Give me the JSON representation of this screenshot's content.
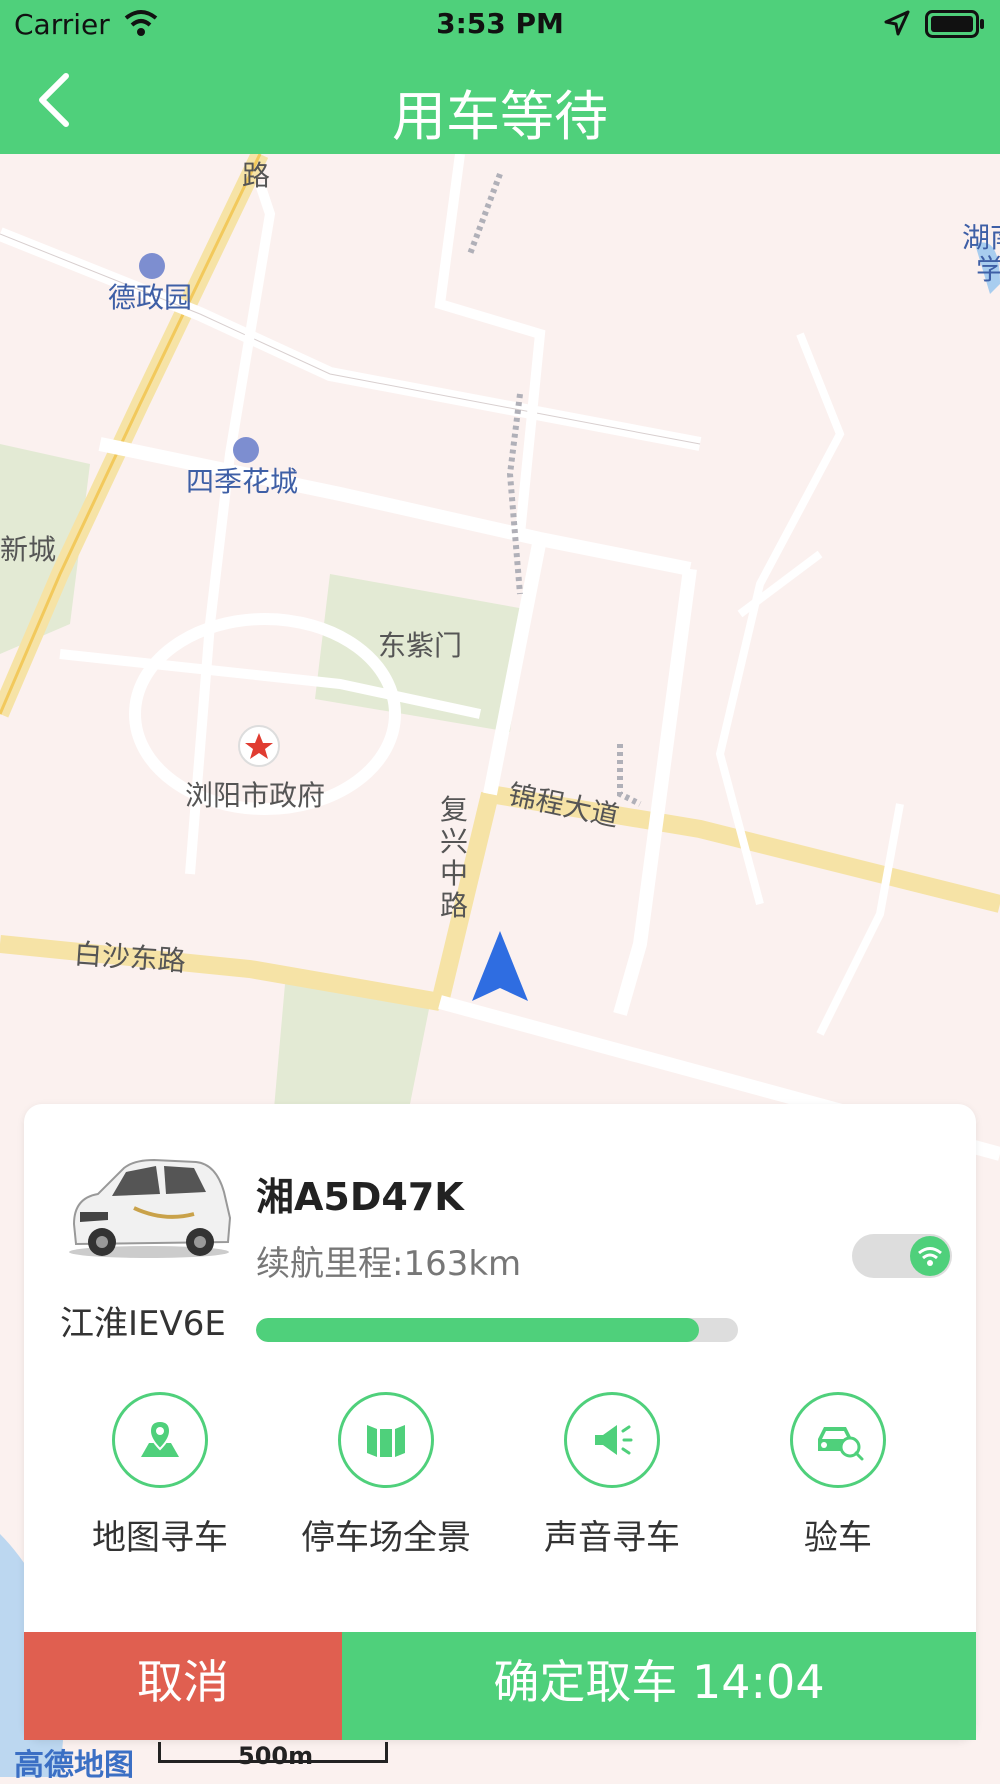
{
  "status_bar": {
    "carrier": "Carrier",
    "time": "3:53 PM"
  },
  "nav": {
    "title": "用车等待"
  },
  "map": {
    "labels": {
      "dezhengyuan": "德政园",
      "sijihuacheng": "四季花城",
      "xincheng": "新城",
      "dongzimen": "东紫门",
      "government": "浏阳市政府",
      "jinchengdadao": "锦程大道",
      "fuxingzhonglu": "复兴中路",
      "baishadonglu": "白沙东路",
      "lu_top": "路",
      "hunan": "湖南",
      "xue": "学"
    },
    "scale": "500m",
    "provider": "高德地图"
  },
  "vehicle": {
    "plate": "湘A5D47K",
    "range_text": "续航里程:163km",
    "model": "江淮IEV6E",
    "battery_fraction": 0.92
  },
  "actions": [
    {
      "label": "地图寻车",
      "icon": "map-pin-icon"
    },
    {
      "label": "停车场全景",
      "icon": "panorama-icon"
    },
    {
      "label": "声音寻车",
      "icon": "horn-icon"
    },
    {
      "label": "验车",
      "icon": "car-inspect-icon"
    }
  ],
  "buttons": {
    "cancel": "取消",
    "confirm": "确定取车 14:04"
  },
  "colors": {
    "primary": "#4fd07b",
    "danger": "#e05f50"
  }
}
